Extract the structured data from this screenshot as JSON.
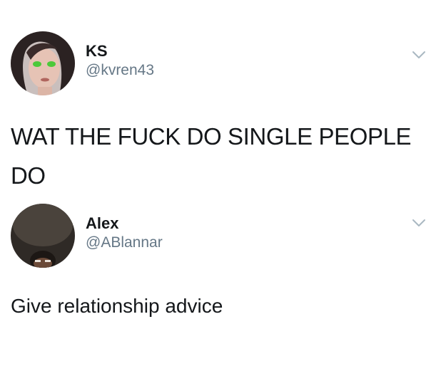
{
  "tweets": [
    {
      "display_name": "KS",
      "handle": "@kvren43",
      "text": "WAT THE FUCK DO SINGLE PEOPLE DO",
      "menu_icon": "chevron-down-icon"
    },
    {
      "display_name": "Alex",
      "handle": "@ABlannar",
      "text": "Give relationship advice",
      "menu_icon": "chevron-down-icon"
    }
  ],
  "colors": {
    "text_primary": "#14171a",
    "text_secondary": "#657786",
    "chevron": "#aab8c2",
    "background": "#ffffff"
  }
}
